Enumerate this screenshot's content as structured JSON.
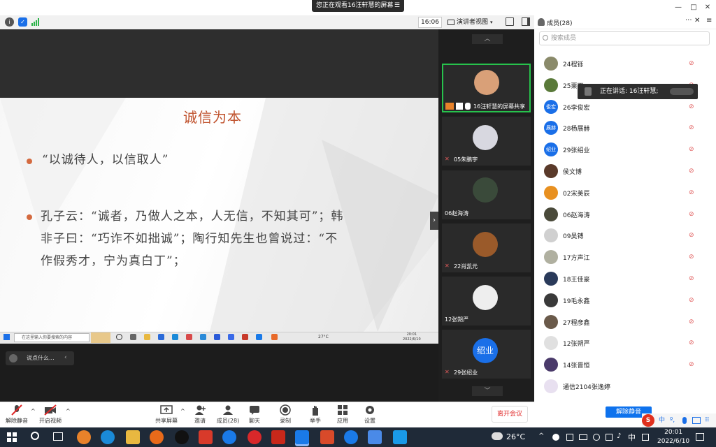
{
  "window": {
    "share_banner": "您正在观看16汪轩慧的屏幕",
    "minimize": "—",
    "restore": "□",
    "close": "✕"
  },
  "toolbar": {
    "time": "16:06",
    "view_mode": "演讲者视图"
  },
  "slide": {
    "title": "诚信为本",
    "bullet1": "“以诚待人，以信取人”",
    "bullet2_line1": "孔子云：“诚者，乃做人之本，人无信，不知其可”；韩",
    "bullet2_line2": "非子曰：“巧诈不如拙诚”；陶行知先生也曾说过：“不",
    "bullet2_line3": "作假秀才，宁为真白丁”；"
  },
  "inner_taskbar": {
    "search_placeholder": "在这里输入你要搜索的内容",
    "temp": "27°C",
    "time": "20:01",
    "date": "2022/6/10"
  },
  "chat": {
    "placeholder": "说点什么..."
  },
  "videos": [
    {
      "name": "16汪轩慧的屏幕共享"
    },
    {
      "name": "05朱鹏宇"
    },
    {
      "name": "06赵海涛"
    },
    {
      "name": "22肖凯元"
    },
    {
      "name": "12张朔严"
    },
    {
      "name": "29张绍业",
      "avatar_text": "绍业"
    }
  ],
  "panel": {
    "title": "成员(28)",
    "search_placeholder": "搜索成员",
    "speaking": "正在讲话: 16汪轩慧;",
    "unmute_all": "解除静音"
  },
  "members": [
    {
      "name": "24程铄",
      "avatar_color": "#8a8a6a",
      "muted": true
    },
    {
      "name": "25栗雨",
      "avatar_color": "#5a7a3a",
      "muted": true
    },
    {
      "name": "26李俊宏",
      "avatar_color": "#1a6fe8",
      "avatar_text": "俊宏",
      "muted": true
    },
    {
      "name": "28杨展赫",
      "avatar_color": "#1a6fe8",
      "avatar_text": "展赫",
      "muted": true
    },
    {
      "name": "29张绍业",
      "avatar_color": "#1a6fe8",
      "avatar_text": "绍业",
      "muted": true
    },
    {
      "name": "侯文博",
      "avatar_color": "#5a3a2a",
      "muted": true
    },
    {
      "name": "02宋美辰",
      "avatar_color": "#e89020",
      "muted": true
    },
    {
      "name": "06赵海涛",
      "avatar_color": "#4a4a3a",
      "muted": true
    },
    {
      "name": "09吴镈",
      "avatar_color": "#d0d0d0",
      "muted": true
    },
    {
      "name": "17方声江",
      "avatar_color": "#b0b0a0",
      "muted": true
    },
    {
      "name": "18王佳豪",
      "avatar_color": "#2a3a5a",
      "muted": true
    },
    {
      "name": "19毛永鑫",
      "avatar_color": "#3a3a3a",
      "muted": true
    },
    {
      "name": "27程彦鑫",
      "avatar_color": "#6a5a4a",
      "muted": true
    },
    {
      "name": "12张朔严",
      "avatar_color": "#e0e0e0",
      "muted": true
    },
    {
      "name": "14张晋恒",
      "avatar_color": "#4a3a6a",
      "muted": true
    },
    {
      "name": "通信2104张逸婷",
      "avatar_color": "#e8e0f0",
      "muted": false
    }
  ],
  "bottom": {
    "unmute": "解除静音",
    "start_video": "开启视频",
    "share_screen": "共享屏幕",
    "invite": "邀请",
    "members": "成员(28)",
    "chat": "聊天",
    "record": "录制",
    "raise_hand": "举手",
    "apps": "应用",
    "settings": "设置",
    "leave": "离开会议"
  },
  "win_taskbar": {
    "temp": "26°C",
    "ime": "中",
    "time": "20:01",
    "date": "2022/6/10"
  },
  "ime_bar": {
    "zh": "中"
  }
}
